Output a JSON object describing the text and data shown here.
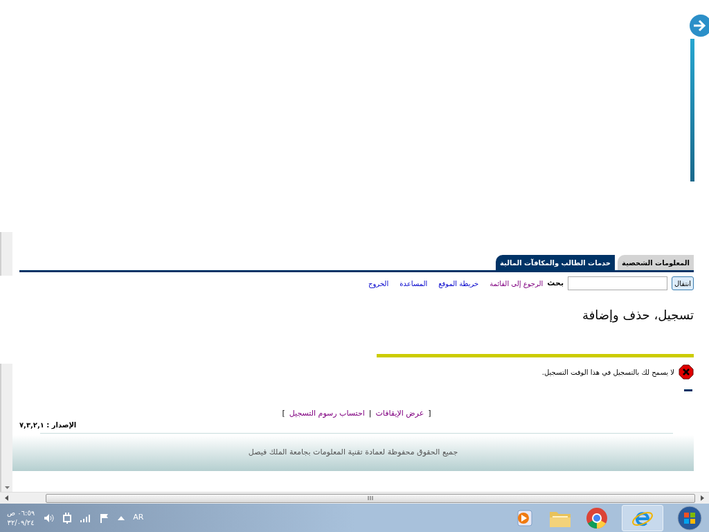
{
  "tabs": [
    {
      "label": "المعلومات الشخصية",
      "selected": false
    },
    {
      "label": "خدمات الطالب والمكافآت المالية",
      "selected": true
    }
  ],
  "toolbar": {
    "go_button": "انتقال",
    "search_label": "بحث",
    "links": [
      {
        "label": "الرجوع إلى القائمة",
        "visited": true
      },
      {
        "label": "خريطة الموقع",
        "visited": false
      },
      {
        "label": "المساعدة",
        "visited": false
      },
      {
        "label": "الخروج",
        "visited": false
      }
    ]
  },
  "heading": "تسجيل، حذف وإضافة",
  "error_message": "لا يسمح لك بالتسجيل في هذا الوقت التسجيل.",
  "bottom_links": {
    "open_bracket": "[",
    "close_bracket": "]",
    "separator": "|",
    "links": [
      {
        "label": "عرض الإيقافات",
        "visited": true
      },
      {
        "label": "احتساب رسوم التسجيل",
        "visited": true
      }
    ]
  },
  "version": "الإصدار : ٧,٣,٢,١",
  "footer": "جميع الحقوق محفوظة لعمادة تقنية المعلومات بجامعة الملك فيصل",
  "taskbar": {
    "language": "AR",
    "time": "٠٦:٥٩ ص",
    "date": "٣٢/٠٩/٢٤"
  }
}
